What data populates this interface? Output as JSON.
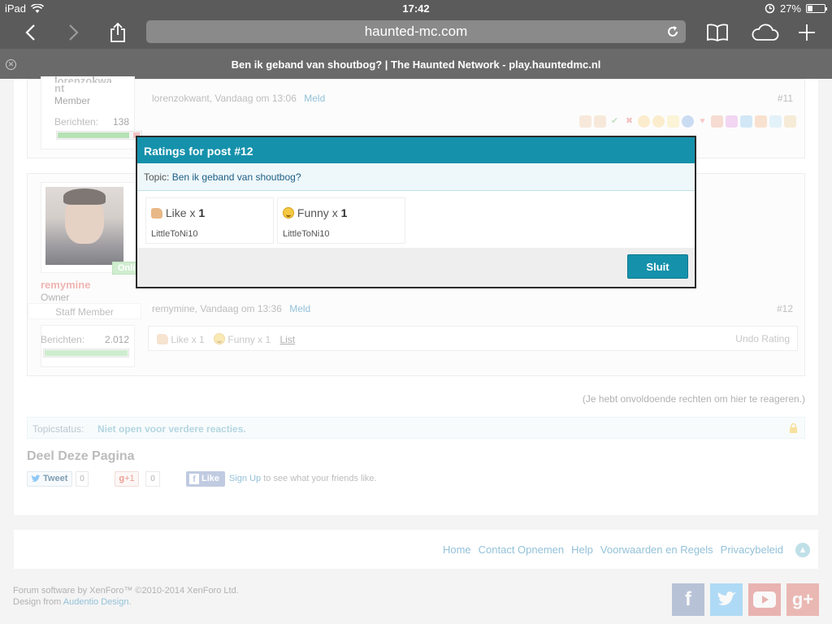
{
  "status_bar": {
    "device": "iPad",
    "time": "17:42",
    "battery": "27%"
  },
  "browser": {
    "url": "haunted-mc.com",
    "tab_title": "Ben ik geband van shoutbog? | The Haunted Network - play.hauntedmc.nl"
  },
  "post11": {
    "username_partial": "lorenzokwa",
    "username_tail": "nt",
    "role": "Member",
    "berichten_label": "Berichten:",
    "berichten_value": "138",
    "meta_author": "lorenzokwant, Vandaag om 13:06",
    "report": "Meld",
    "post_number": "#11"
  },
  "post12": {
    "online_badge": "Online",
    "username": "remymine",
    "role": "Owner",
    "staff_label": "Staff Member",
    "berichten_label": "Berichten:",
    "berichten_value": "2.012",
    "meta_author": "remymine, Vandaag om 13:36",
    "report": "Meld",
    "post_number": "#12",
    "ratings": {
      "like": "Like x ",
      "like_count": "1",
      "funny": "Funny x ",
      "funny_count": "1",
      "list": "List",
      "undo": "Undo Rating"
    }
  },
  "notice": "(Je hebt onvoldoende rechten om hier te reageren.)",
  "topic_status": {
    "label": "Topicstatus:",
    "value": "Niet open voor verdere reacties."
  },
  "share": {
    "title": "Deel Deze Pagina",
    "tweet": "Tweet",
    "tweet_count": "0",
    "gplus": "+1",
    "gplus_count": "0",
    "fb_like": "Like",
    "fb_signup": "Sign Up",
    "fb_text": " to see what your friends like."
  },
  "modal": {
    "title": "Ratings for post #12",
    "topic_label": "Topic:",
    "topic_value": "Ben ik geband van shoutbog?",
    "ratings": [
      {
        "label": "Like x ",
        "count": "1",
        "user": "LittleToNi10"
      },
      {
        "label": "Funny x ",
        "count": "1",
        "user": "LittleToNi10"
      }
    ],
    "close": "Sluit"
  },
  "footer": {
    "links": [
      "Home",
      "Contact Opnemen",
      "Help",
      "Voorwaarden en Regels",
      "Privacybeleid"
    ],
    "copyright_line1": "Forum software by XenForo™ ©2010-2014 XenForo Ltd.",
    "design_prefix": "Design from ",
    "design_link": "Audentio Design",
    "design_suffix": "."
  },
  "colors": {
    "accent": "#1591ab",
    "link": "#5aa0c4",
    "username": "#d9443e"
  }
}
